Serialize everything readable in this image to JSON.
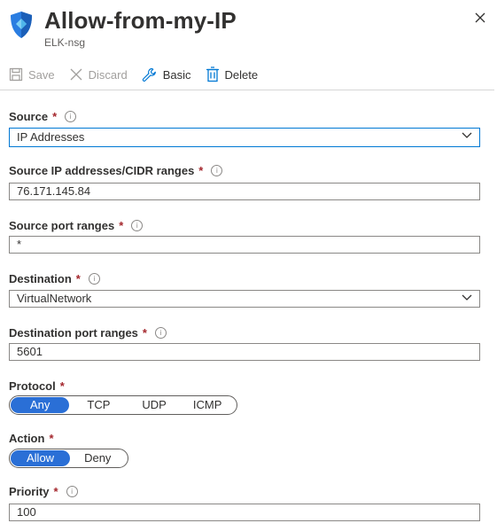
{
  "header": {
    "title": "Allow-from-my-IP",
    "subtitle": "ELK-nsg"
  },
  "toolbar": {
    "save_label": "Save",
    "discard_label": "Discard",
    "basic_label": "Basic",
    "delete_label": "Delete"
  },
  "form": {
    "required_mark": "*",
    "info_glyph": "i",
    "source": {
      "label": "Source",
      "value": "IP Addresses"
    },
    "source_ip": {
      "label": "Source IP addresses/CIDR ranges",
      "value": "76.171.145.84"
    },
    "source_port": {
      "label": "Source port ranges",
      "value": "*"
    },
    "destination": {
      "label": "Destination",
      "value": "VirtualNetwork"
    },
    "destination_port": {
      "label": "Destination port ranges",
      "value": "5601"
    },
    "protocol": {
      "label": "Protocol",
      "options": [
        "Any",
        "TCP",
        "UDP",
        "ICMP"
      ],
      "selected": "Any"
    },
    "action": {
      "label": "Action",
      "options": [
        "Allow",
        "Deny"
      ],
      "selected": "Allow"
    },
    "priority": {
      "label": "Priority",
      "value": "100"
    }
  },
  "colors": {
    "accent": "#2a6fd6",
    "required": "#a4262c",
    "shield_blue": "#2a7de1"
  }
}
